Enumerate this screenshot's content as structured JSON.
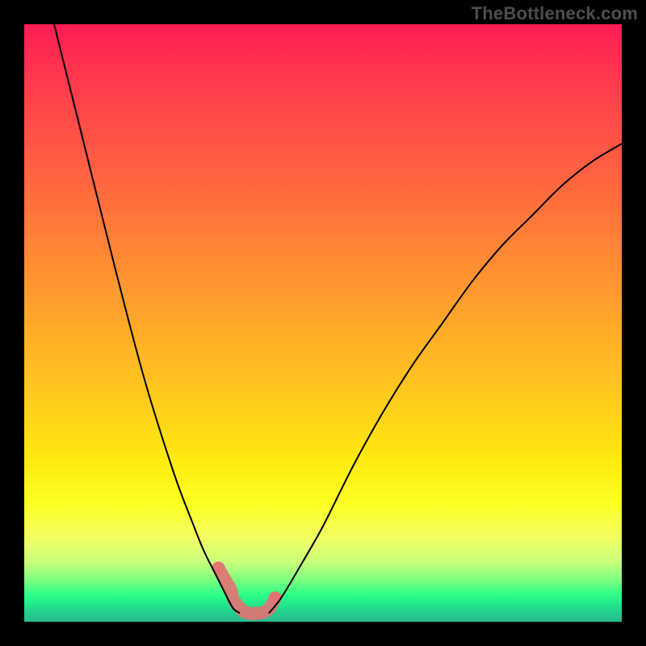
{
  "watermark": "TheBottleneck.com",
  "colors": {
    "frame": "#000000",
    "curve": "#000000",
    "valley_marker": "#e17474",
    "gradient_top": "#ff1c53",
    "gradient_mid": "#ffe70f",
    "gradient_bottom": "#29b88e"
  },
  "chart_data": {
    "type": "line",
    "title": "",
    "xlabel": "",
    "ylabel": "",
    "xlim": [
      0,
      100
    ],
    "ylim": [
      0,
      100
    ],
    "grid": false,
    "legend": false,
    "note": "Two asymmetric curves descending into a near-zero valley around x≈35–41; background hue encodes y-value (red high → green low). Values estimated from pixel positions.",
    "series": [
      {
        "name": "left_branch",
        "x": [
          5,
          10,
          15,
          20,
          25,
          28,
          30,
          32,
          34,
          35,
          36
        ],
        "y": [
          100,
          80,
          60,
          41,
          25,
          17,
          12,
          8,
          4,
          2.2,
          1.5
        ]
      },
      {
        "name": "right_branch",
        "x": [
          41,
          43,
          46,
          50,
          55,
          60,
          65,
          70,
          75,
          80,
          85,
          90,
          95,
          100
        ],
        "y": [
          1.5,
          4,
          9,
          16,
          26,
          35,
          43,
          50,
          57,
          63,
          68,
          73,
          77,
          80
        ]
      }
    ],
    "valley_marker": {
      "x": [
        32.5,
        33.5,
        34.5,
        35,
        36,
        37,
        38,
        39,
        40,
        41,
        41.5,
        42
      ],
      "y": [
        9,
        7.2,
        5.5,
        3.8,
        2.4,
        1.6,
        1.4,
        1.4,
        1.6,
        2.2,
        3.0,
        4.0
      ]
    }
  }
}
